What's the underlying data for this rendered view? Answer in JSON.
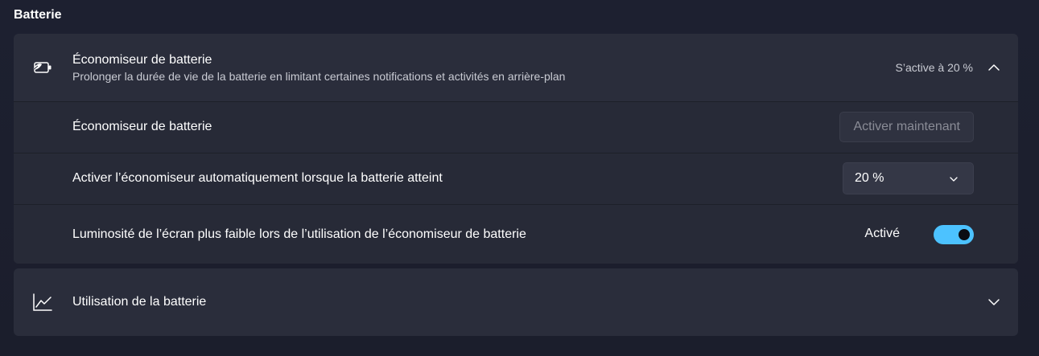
{
  "section": {
    "title": "Batterie"
  },
  "saver": {
    "title": "Économiseur de batterie",
    "description": "Prolonger la durée de vie de la batterie en limitant certaines notifications et activités en arrière-plan",
    "status": "S’active à 20 %",
    "icon": "battery-saver-icon",
    "expanded": true
  },
  "saver_row": {
    "label": "Économiseur de batterie",
    "button_label": "Activer maintenant",
    "button_disabled": true
  },
  "threshold_row": {
    "label": "Activer l’économiseur automatiquement lorsque la batterie atteint",
    "selected_value": "20 %"
  },
  "brightness_row": {
    "label": "Luminosité de l’écran plus faible lors de l’utilisation de l’économiseur de batterie",
    "toggle_state_label": "Activé",
    "toggle_on": true
  },
  "usage": {
    "title": "Utilisation de la batterie",
    "icon": "chart-line-icon",
    "expanded": false
  },
  "colors": {
    "accent": "#4cc2ff",
    "card": "#2a2d3b",
    "background": "#1c1f2b"
  }
}
